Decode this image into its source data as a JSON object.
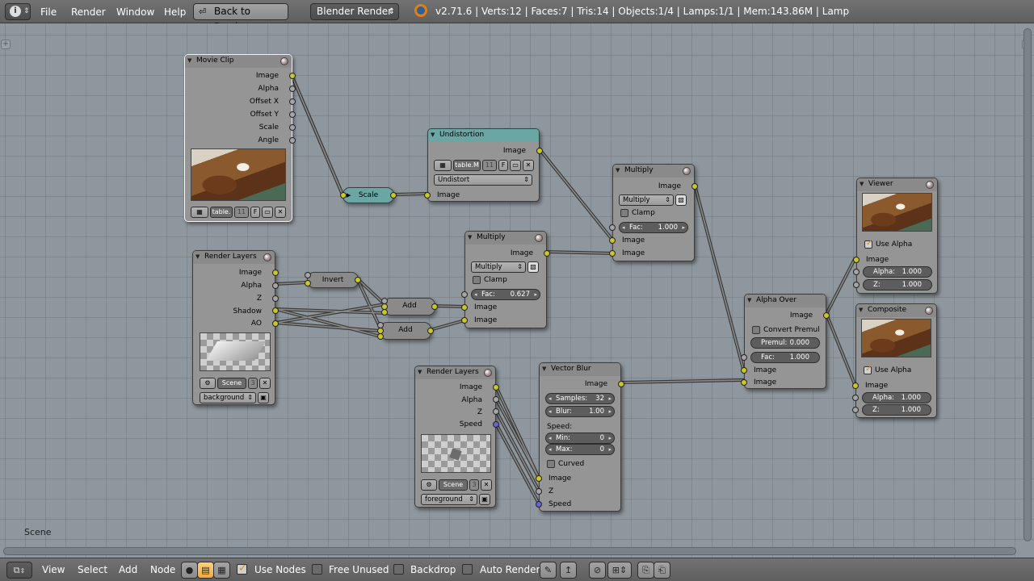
{
  "topbar": {
    "menu": [
      "File",
      "Render",
      "Window",
      "Help"
    ],
    "back_label": "Back to Previous",
    "engine": "Blender Render",
    "stats": "v2.71.6 | Verts:12 | Faces:7 | Tris:14 | Objects:1/4 | Lamps:1/1 | Mem:143.86M | Lamp"
  },
  "nodes": {
    "movie_clip": {
      "title": "Movie Clip",
      "outputs": [
        "Image",
        "Alpha",
        "Offset X",
        "Offset Y",
        "Scale",
        "Angle"
      ],
      "clip_name": "table.",
      "clip_users": "11",
      "fake": "F"
    },
    "scale": {
      "title": "Scale"
    },
    "undistortion": {
      "title": "Undistortion",
      "out": "Image",
      "clip_name": "table.M",
      "clip_users": "11",
      "fake": "F",
      "mode": "Undistort",
      "in": "Image"
    },
    "render_layers_1": {
      "title": "Render Layers",
      "outputs": [
        "Image",
        "Alpha",
        "Z",
        "Shadow",
        "AO"
      ],
      "scene": "Scene",
      "scene_num": "3",
      "layer": "background"
    },
    "invert": {
      "title": "Invert"
    },
    "add1": {
      "title": "Add"
    },
    "add2": {
      "title": "Add"
    },
    "multiply1": {
      "title": "Multiply",
      "out": "Image",
      "mode": "Multiply",
      "clamp": "Clamp",
      "fac_label": "Fac:",
      "fac": "0.627",
      "in1": "Image",
      "in2": "Image"
    },
    "multiply2": {
      "title": "Multiply",
      "out": "Image",
      "mode": "Multiply",
      "clamp": "Clamp",
      "fac_label": "Fac:",
      "fac": "1.000",
      "in1": "Image",
      "in2": "Image"
    },
    "render_layers_2": {
      "title": "Render Layers",
      "outputs": [
        "Image",
        "Alpha",
        "Z",
        "Speed"
      ],
      "scene": "Scene",
      "scene_num": "3",
      "layer": "foreground"
    },
    "vector_blur": {
      "title": "Vector Blur",
      "out": "Image",
      "samples_label": "Samples:",
      "samples": "32",
      "blur_label": "Blur:",
      "blur": "1.00",
      "speed_label": "Speed:",
      "min_label": "Min:",
      "min": "0",
      "max_label": "Max:",
      "max": "0",
      "curved": "Curved",
      "inputs": [
        "Image",
        "Z",
        "Speed"
      ]
    },
    "alpha_over": {
      "title": "Alpha Over",
      "out": "Image",
      "convert": "Convert Premul",
      "premul_label": "Premul:",
      "premul": "0.000",
      "fac_label": "Fac:",
      "fac": "1.000",
      "in1": "Image",
      "in2": "Image"
    },
    "viewer": {
      "title": "Viewer",
      "use_alpha": "Use Alpha",
      "in": "Image",
      "alpha_label": "Alpha:",
      "alpha": "1.000",
      "z_label": "Z:",
      "z": "1.000"
    },
    "composite": {
      "title": "Composite",
      "use_alpha": "Use Alpha",
      "in": "Image",
      "alpha_label": "Alpha:",
      "alpha": "1.000",
      "z_label": "Z:",
      "z": "1.000"
    }
  },
  "editor": {
    "scene_label": "Scene"
  },
  "bottombar": {
    "menu": [
      "View",
      "Select",
      "Add",
      "Node"
    ],
    "use_nodes": "Use Nodes",
    "free_unused": "Free Unused",
    "backdrop": "Backdrop",
    "auto_render": "Auto Render"
  },
  "colors": {
    "socket_image": "#c8c628",
    "socket_value": "#a5a5a5",
    "socket_vector": "#6365d2",
    "header_teal": "#6aa6a4",
    "checkbox_accent": "#e08a12"
  }
}
